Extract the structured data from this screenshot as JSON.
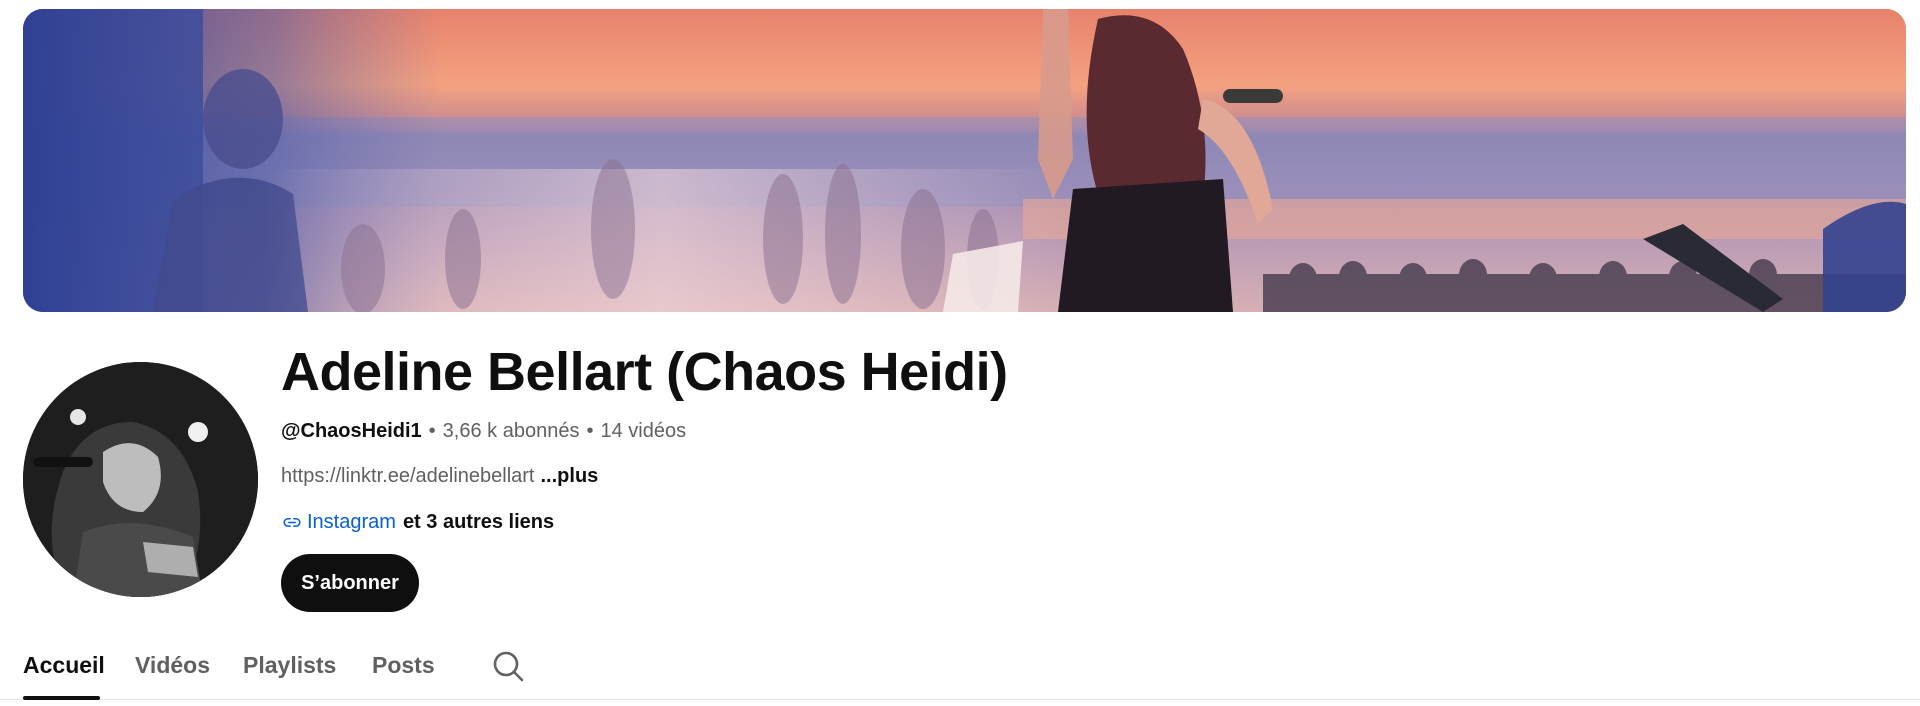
{
  "channel": {
    "name": "Adeline Bellart (Chaos Heidi)",
    "handle": "@ChaosHeidi1",
    "subscribers": "3,66 k abonnés",
    "videos": "14 vidéos",
    "description": "https://linktr.ee/adelinebellart",
    "more_label": "...plus",
    "first_link": "Instagram",
    "other_links": "et 3 autres liens",
    "subscribe_label": "S’abonner"
  },
  "tabs": [
    {
      "label": "Accueil",
      "active": true
    },
    {
      "label": "Vidéos",
      "active": false
    },
    {
      "label": "Playlists",
      "active": false
    },
    {
      "label": "Posts",
      "active": false
    }
  ],
  "icons": {
    "link": "link-icon",
    "search": "search-icon"
  },
  "colors": {
    "subscribe_bg": "#0f0f0f",
    "link_blue": "#065fd4",
    "secondary_text": "#606060"
  }
}
